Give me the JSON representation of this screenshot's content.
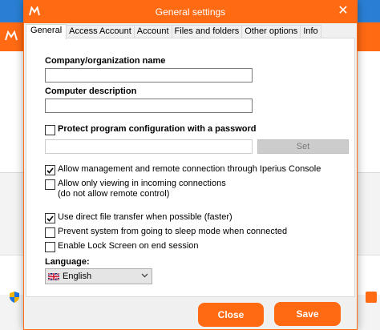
{
  "dialog": {
    "title": "General settings",
    "close_glyph": "✕"
  },
  "tabs": [
    {
      "label": "General"
    },
    {
      "label": "Access Account"
    },
    {
      "label": "Account"
    },
    {
      "label": "Files and folders"
    },
    {
      "label": "Other options"
    },
    {
      "label": "Info"
    }
  ],
  "general": {
    "org_label": "Company/organization name",
    "org_value": "",
    "desc_label": "Computer description",
    "desc_value": "",
    "protect_label": "Protect program configuration with a password",
    "protect_checked": false,
    "password_value": "",
    "set_label": "Set",
    "options": [
      {
        "label": "Allow management and remote connection through Iperius Console",
        "checked": true
      },
      {
        "label": "Allow only viewing in incoming connections",
        "label2": "(do not allow remote control)",
        "checked": false
      },
      {
        "label": "Use direct file transfer when possible (faster)",
        "checked": true
      },
      {
        "label": "Prevent system from going to sleep mode when connected",
        "checked": false
      },
      {
        "label": "Enable Lock Screen on end session",
        "checked": false
      }
    ],
    "language_label": "Language:",
    "language_value": "English",
    "language_flag_icon": "uk-flag-icon"
  },
  "buttons": {
    "close_label": "Close",
    "save_label": "Save"
  },
  "colors": {
    "accent": "#ff6a13",
    "desktop": "#2a7fd4"
  }
}
